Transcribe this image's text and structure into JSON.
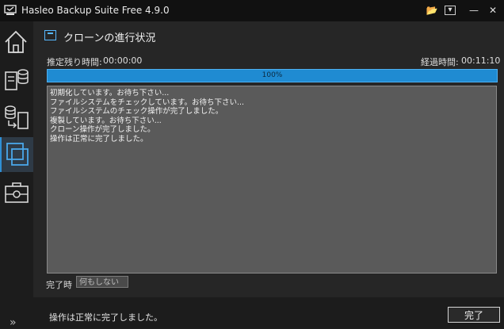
{
  "window": {
    "title": "Hasleo Backup Suite Free 4.9.0",
    "controls": {
      "folder": "📂",
      "menu": "▾",
      "minimize": "—",
      "close": "✕"
    }
  },
  "sidebar": {
    "items": [
      {
        "name": "home"
      },
      {
        "name": "backup"
      },
      {
        "name": "restore"
      },
      {
        "name": "clone",
        "active": true
      },
      {
        "name": "tools"
      }
    ],
    "expand_glyph": "»"
  },
  "header": {
    "title": "クローンの進行状況"
  },
  "stats": {
    "remaining_label": "推定残り時間:",
    "remaining_value": "00:00:00",
    "elapsed_label": "経過時間:",
    "elapsed_value": "00:11:10"
  },
  "progress": {
    "percent": 100,
    "label": "100%"
  },
  "log": {
    "lines": [
      "初期化しています。お待ち下さい...",
      "ファイルシステムをチェックしています。お待ち下さい...",
      "ファイルシステムのチェック操作が完了しました。",
      "複製しています。お待ち下さい...",
      "クローン操作が完了しました。",
      "操作は正常に完了しました。"
    ]
  },
  "after_completion": {
    "label": "完了時",
    "value": "何もしない"
  },
  "footer": {
    "status": "操作は正常に完了しました。",
    "finish_button": "完了"
  },
  "colors": {
    "accent": "#1f8bd2",
    "background": "#1f1f1f",
    "log_background": "#5a5a5a"
  }
}
